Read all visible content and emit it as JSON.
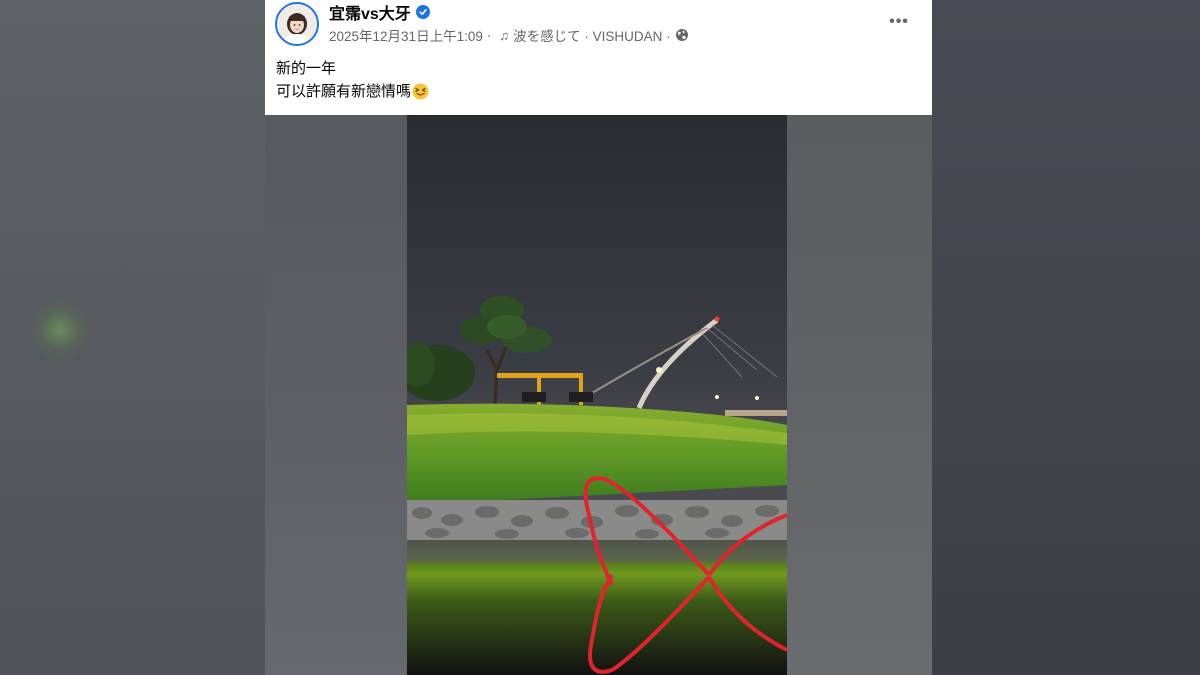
{
  "post": {
    "author": "宜霈vs大牙",
    "verified": true,
    "timestamp": "2025年12月31日上午1:09",
    "music": "波を感じて · VISHUDAN ·",
    "privacy_icon": "globe-icon",
    "more_icon": "more-dots-icon",
    "more_label": "•••",
    "caption_line1": "新的一年",
    "caption_line2": "可以許願有新戀情嗎",
    "caption_emoji": "squinting-tongue-emoji"
  },
  "colors": {
    "accent": "#1b74e4",
    "meta_text": "#65676b",
    "heart_sculpture": "#e0242e"
  }
}
